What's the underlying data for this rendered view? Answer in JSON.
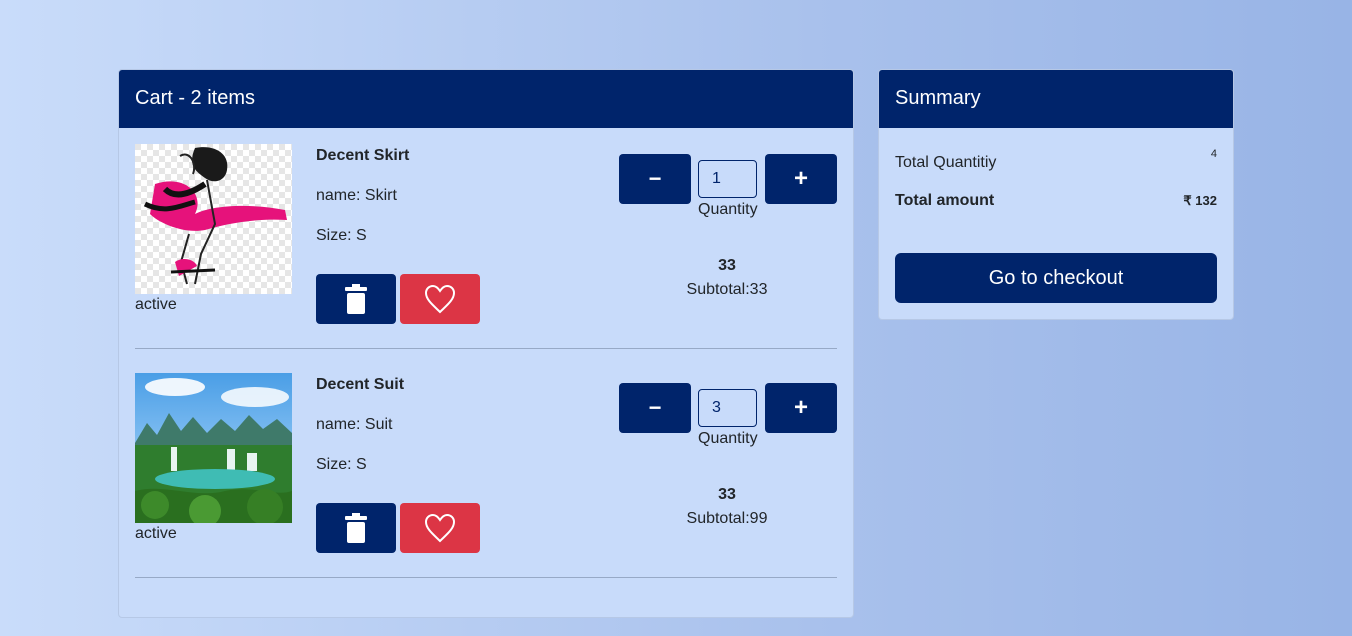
{
  "cart": {
    "title": "Cart - 2 items",
    "items": [
      {
        "name": "Decent Skirt",
        "field_name": "name: Skirt",
        "size": "Size: S",
        "status": "active",
        "image_icon": "fashion-sketch-image",
        "quantity": "1",
        "quantity_label": "Quantity",
        "price": "33",
        "subtotal": "Subtotal:33",
        "decrement_label": "−",
        "increment_label": "+"
      },
      {
        "name": "Decent Suit",
        "field_name": "name: Suit",
        "size": "Size: S",
        "status": "active",
        "image_icon": "waterfall-landscape-image",
        "quantity": "3",
        "quantity_label": "Quantity",
        "price": "33",
        "subtotal": "Subtotal:99",
        "decrement_label": "−",
        "increment_label": "+"
      }
    ]
  },
  "summary": {
    "title": "Summary",
    "total_quantity_label": "Total Quantitiy",
    "total_quantity_value": "4",
    "total_amount_label": "Total amount",
    "total_amount_value": "₹ 132",
    "checkout_label": "Go to checkout"
  },
  "colors": {
    "primary": "#00246b",
    "danger": "#dc3545",
    "card_bg": "#c8dbfa"
  }
}
